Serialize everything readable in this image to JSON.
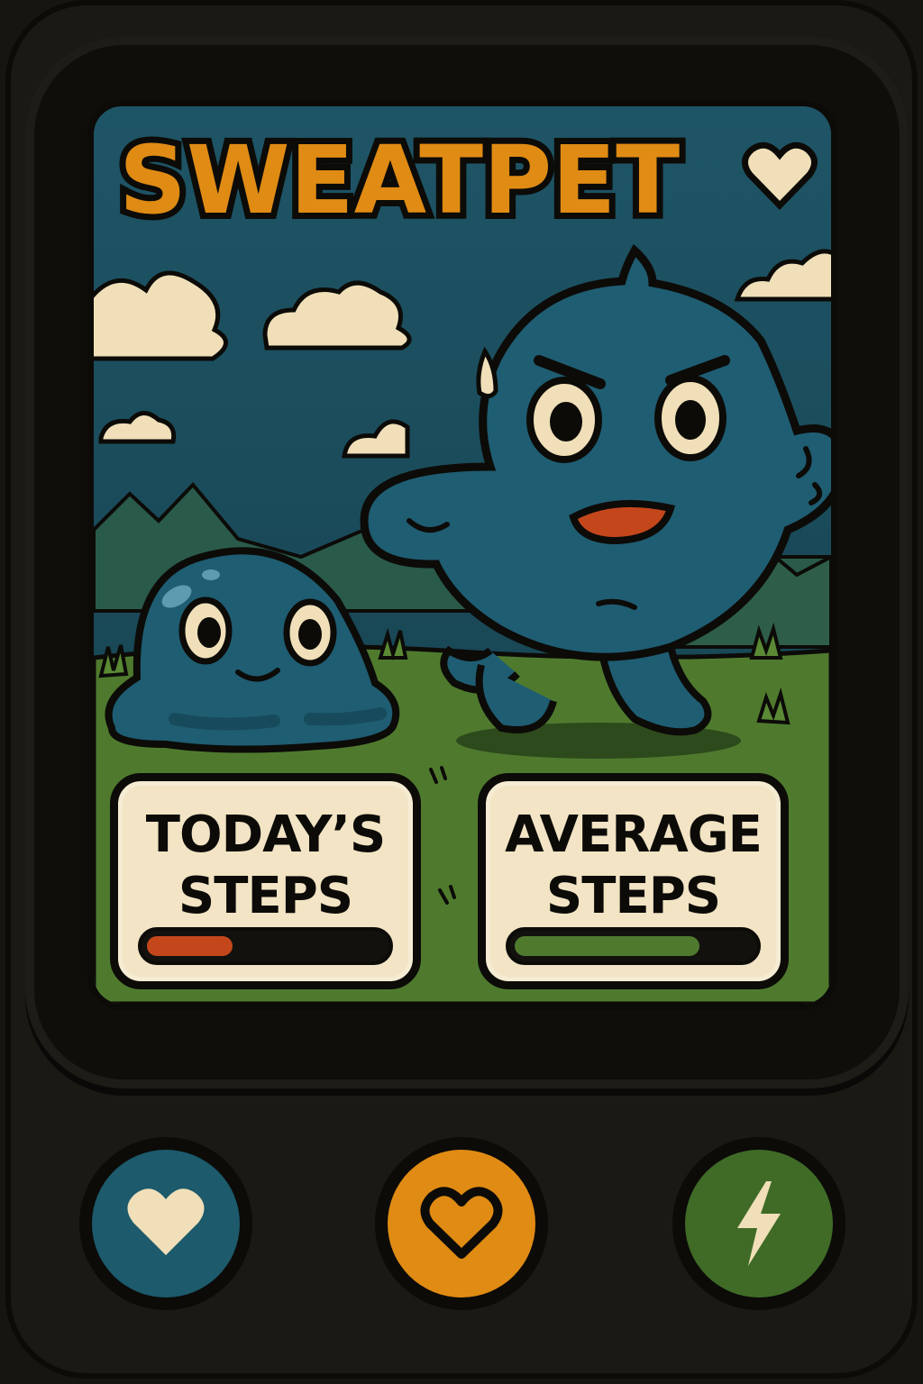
{
  "app": {
    "title": "SWEATPET",
    "title_icon": "heart-icon"
  },
  "pets": [
    {
      "name": "blob-pet",
      "mood": "happy"
    },
    {
      "name": "runner-pet",
      "mood": "determined"
    }
  ],
  "stats": {
    "today": {
      "label_line1": "TODAY’S",
      "label_line2": "STEPS",
      "progress": 0.36,
      "color": "#c4471c"
    },
    "average": {
      "label_line1": "AVERAGE",
      "label_line2": "STEPS",
      "progress": 0.78,
      "color": "#4f7a2e"
    }
  },
  "nav": [
    {
      "name": "heart-icon",
      "color": "#1c5a6c"
    },
    {
      "name": "heart-outline-icon",
      "color": "#e08b14"
    },
    {
      "name": "lightning-icon",
      "color": "#3f6b27"
    }
  ],
  "colors": {
    "sky": "#1d4f5e",
    "grass": "#4f7a2e",
    "pet_body": "#1f5d72",
    "cream": "#f2e4c4",
    "accent": "#e08b14",
    "outline": "#0c0b08"
  }
}
